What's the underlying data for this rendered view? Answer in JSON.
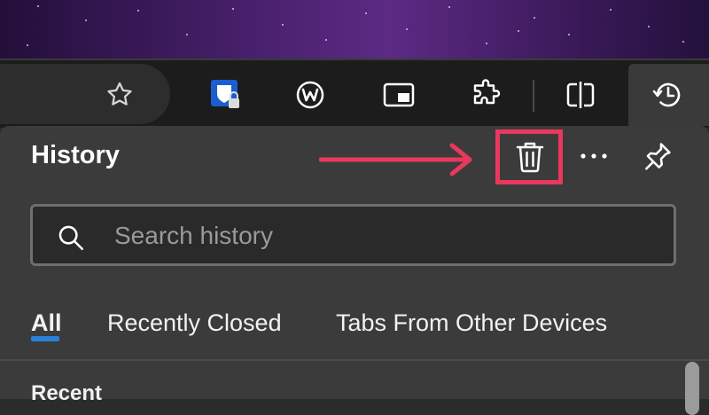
{
  "panel": {
    "title": "History"
  },
  "search": {
    "placeholder": "Search history",
    "value": ""
  },
  "tabs": [
    {
      "label": "All",
      "selected": true
    },
    {
      "label": "Recently Closed",
      "selected": false
    },
    {
      "label": "Tabs From Other Devices",
      "selected": false
    }
  ],
  "list": {
    "section_label": "Recent"
  },
  "toolbar": {
    "icons": [
      "star-icon",
      "bitwarden-lock-icon",
      "w-extension-icon",
      "picture-in-picture-icon",
      "extensions-puzzle-icon",
      "split-screen-icon",
      "history-icon"
    ]
  },
  "panel_actions": {
    "icons": [
      "trash-icon",
      "more-options-icon",
      "pin-icon"
    ]
  },
  "colors": {
    "highlight": "#e8385c",
    "accent": "#2a7fd8",
    "panel_bg": "#3b3b3b",
    "toolbar_bg": "#1c1c1c"
  }
}
